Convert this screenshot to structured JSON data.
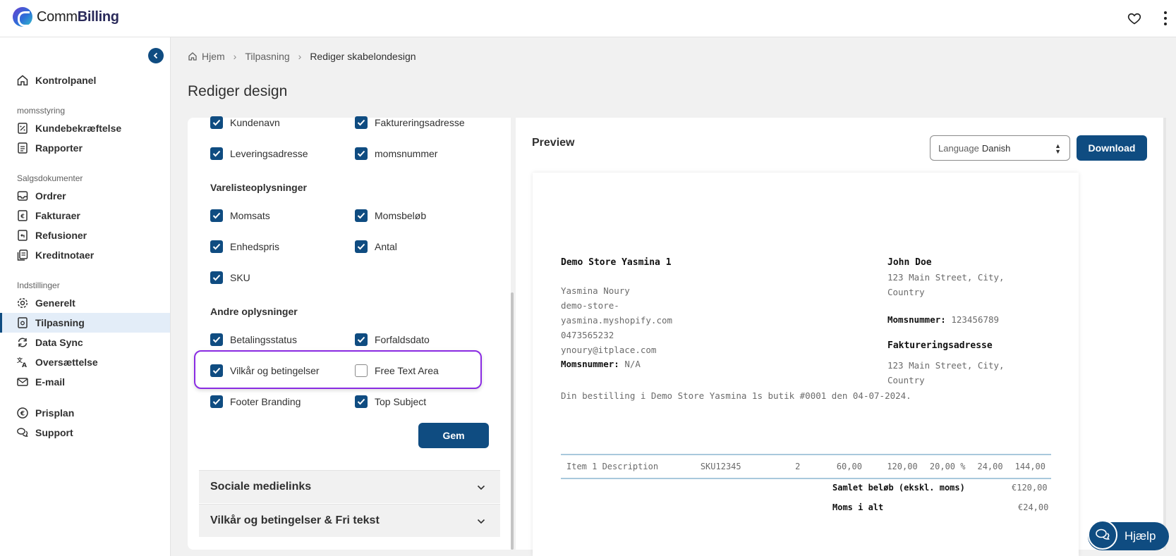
{
  "app": {
    "logo_regular": "Comm",
    "logo_bold": "Billing"
  },
  "sidebar": {
    "dashboard": "Kontrolpanel",
    "section_tax": "momsstyring",
    "customer_confirmation": "Kundebekræftelse",
    "reports": "Rapporter",
    "section_sales": "Salgsdokumenter",
    "orders": "Ordrer",
    "invoices": "Fakturaer",
    "refunds": "Refusioner",
    "credit_notes": "Kreditnotaer",
    "section_settings": "Indstillinger",
    "general": "Generelt",
    "customization": "Tilpasning",
    "data_sync": "Data Sync",
    "translate": "Oversættelse",
    "email": "E-mail",
    "pricing": "Prisplan",
    "support": "Support"
  },
  "breadcrumb": {
    "home": "Hjem",
    "customization": "Tilpasning",
    "current": "Rediger skabelondesign"
  },
  "page_title": "Rediger design",
  "options": {
    "customer_name": "Kundenavn",
    "billing_address": "Faktureringsadresse",
    "shipping_address": "Leveringsadresse",
    "vat_number": "momsnummer",
    "line_items_heading": "Varelisteoplysninger",
    "tax_rate": "Momsats",
    "tax_amount": "Momsbeløb",
    "unit_price": "Enhedspris",
    "quantity": "Antal",
    "sku": "SKU",
    "other_heading": "Andre oplysninger",
    "payment_status": "Betalingsstatus",
    "due_date": "Forfaldsdato",
    "terms": "Vilkår og betingelser",
    "free_text": "Free Text Area",
    "footer_branding": "Footer Branding",
    "top_subject": "Top Subject"
  },
  "save_label": "Gem",
  "accordions": {
    "social": "Sociale medielinks",
    "terms_free_text": "Vilkår og betingelser & Fri tekst"
  },
  "preview": {
    "title": "Preview",
    "language_label": "Language",
    "language_value": "Danish",
    "download_label": "Download"
  },
  "invoice": {
    "store_name": "Demo Store Yasmina 1",
    "store_lines": [
      "Yasmina Noury",
      "demo-store-",
      "yasmina.myshopify.com",
      "0473565232",
      "ynoury@itplace.com"
    ],
    "store_vat_label": "Momsnummer:",
    "store_vat_value": "N/A",
    "customer_name": "John Doe",
    "customer_address_1": "123 Main Street, City,",
    "customer_address_2": "Country",
    "customer_vat_label": "Momsnummer:",
    "customer_vat_value": "123456789",
    "billing_heading": "Faktureringsadresse",
    "billing_address_1": "123 Main Street, City,",
    "billing_address_2": "Country",
    "order_text": "Din bestilling i Demo Store Yasmina 1s butik #0001 den 04-07-2024.",
    "item": {
      "description": "Item 1 Description",
      "sku": "SKU12345",
      "qty": "2",
      "unit_price": "60,00",
      "subtotal": "120,00",
      "tax_rate": "20,00 %",
      "tax": "24,00",
      "total": "144,00"
    },
    "total_excl_label": "Samlet beløb (ekskl. moms)",
    "total_excl_value": "€120,00",
    "vat_total_label": "Moms i alt",
    "vat_total_value": "€24,00"
  },
  "help_label": "Hjælp"
}
